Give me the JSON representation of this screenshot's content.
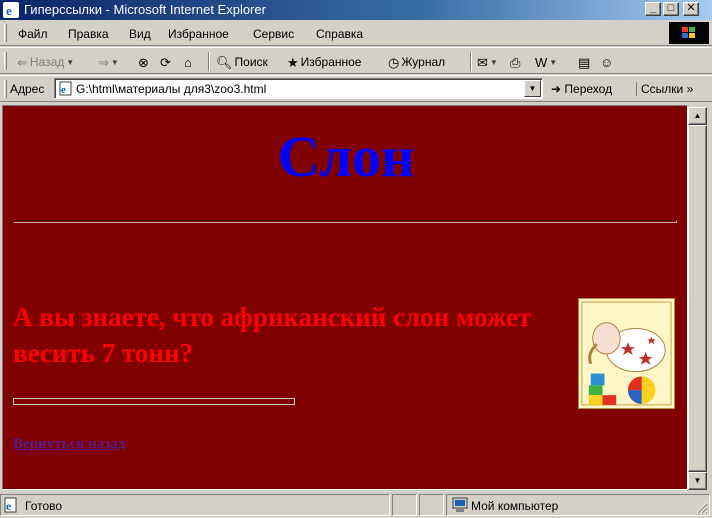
{
  "window": {
    "title": "Гиперссылки - Microsoft Internet Explorer",
    "icon": "ie-icon",
    "controls": {
      "minimize": "minimize-icon",
      "maximize": "maximize-icon",
      "close": "close-icon"
    }
  },
  "menu": {
    "items": [
      "Файл",
      "Правка",
      "Вид",
      "Избранное",
      "Сервис",
      "Справка"
    ]
  },
  "toolbar": {
    "back_label": "Назад",
    "search_label": "Поиск",
    "favorites_label": "Избранное",
    "history_label": "Журнал"
  },
  "address": {
    "label": "Адрес",
    "url": "G:\\html\\материалы для3\\zoo3.html",
    "go_label": "Переход",
    "links_label": "Ссылки"
  },
  "page": {
    "background": "#800000",
    "title": "Слон",
    "title_color": "#0000ff",
    "fact": "А вы знаете, что африканский слон может весить 7 тонн?",
    "fact_color": "#ff0000",
    "back_link": "Вернуться назад",
    "image": "elephant-toy-icon"
  },
  "status": {
    "text": "Готово",
    "zone": "Мой компьютер"
  }
}
